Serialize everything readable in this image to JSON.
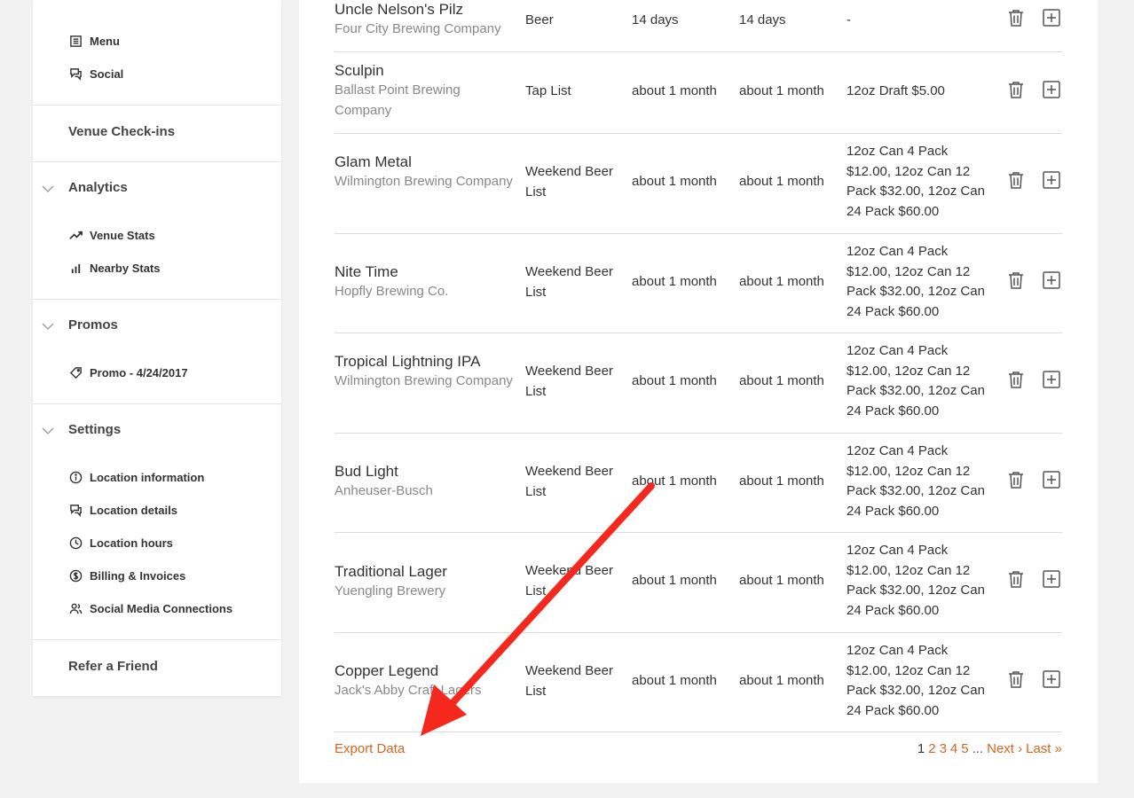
{
  "sidebar": {
    "top_items": [
      {
        "label": "Menu",
        "icon": "menu-icon"
      },
      {
        "label": "Social",
        "icon": "chat-icon"
      }
    ],
    "venue_checkins": "Venue Check-ins",
    "analytics": {
      "title": "Analytics",
      "items": [
        {
          "label": "Venue Stats",
          "icon": "trending-icon"
        },
        {
          "label": "Nearby Stats",
          "icon": "bar-chart-icon"
        }
      ]
    },
    "promos": {
      "title": "Promos",
      "items": [
        {
          "label": "Promo - 4/24/2017",
          "icon": "tag-icon"
        }
      ]
    },
    "settings": {
      "title": "Settings",
      "items": [
        {
          "label": "Location information",
          "icon": "info-icon"
        },
        {
          "label": "Location details",
          "icon": "chat-icon"
        },
        {
          "label": "Location hours",
          "icon": "clock-icon"
        },
        {
          "label": "Billing & Invoices",
          "icon": "dollar-icon"
        },
        {
          "label": "Social Media Connections",
          "icon": "users-icon"
        }
      ]
    },
    "refer": "Refer a Friend"
  },
  "table": {
    "rows": [
      {
        "name": "Uncle Nelson's Pilz",
        "brewery": "Four City Brewing Company",
        "list": "Beer",
        "added": "14 days",
        "updated": "14 days",
        "price": "-"
      },
      {
        "name": "Sculpin",
        "brewery": "Ballast Point Brewing Company",
        "list": "Tap List",
        "added": "about 1 month",
        "updated": "about 1 month",
        "price": "12oz Draft $5.00"
      },
      {
        "name": "Glam Metal",
        "brewery": "Wilmington Brewing Company",
        "list": "Weekend Beer List",
        "added": "about 1 month",
        "updated": "about 1 month",
        "price": "12oz Can 4 Pack $12.00, 12oz Can 12 Pack $32.00, 12oz Can 24 Pack $60.00"
      },
      {
        "name": "Nite Time",
        "brewery": "Hopfly Brewing Co.",
        "list": "Weekend Beer List",
        "added": "about 1 month",
        "updated": "about 1 month",
        "price": "12oz Can 4 Pack $12.00, 12oz Can 12 Pack $32.00, 12oz Can 24 Pack $60.00"
      },
      {
        "name": "Tropical Lightning IPA",
        "brewery": "Wilmington Brewing Company",
        "list": "Weekend Beer List",
        "added": "about 1 month",
        "updated": "about 1 month",
        "price": "12oz Can 4 Pack $12.00, 12oz Can 12 Pack $32.00, 12oz Can 24 Pack $60.00"
      },
      {
        "name": "Bud Light",
        "brewery": "Anheuser-Busch",
        "list": "Weekend Beer List",
        "added": "about 1 month",
        "updated": "about 1 month",
        "price": "12oz Can 4 Pack $12.00, 12oz Can 12 Pack $32.00, 12oz Can 24 Pack $60.00"
      },
      {
        "name": "Traditional Lager",
        "brewery": "Yuengling Brewery",
        "list": "Weekend Beer List",
        "added": "about 1 month",
        "updated": "about 1 month",
        "price": "12oz Can 4 Pack $12.00, 12oz Can 12 Pack $32.00, 12oz Can 24 Pack $60.00"
      },
      {
        "name": "Copper Legend",
        "brewery": "Jack's Abby Craft Lagers",
        "list": "Weekend Beer List",
        "added": "about 1 month",
        "updated": "about 1 month",
        "price": "12oz Can 4 Pack $12.00, 12oz Can 12 Pack $32.00, 12oz Can 24 Pack $60.00"
      }
    ]
  },
  "footer": {
    "export_label": "Export Data",
    "pagination": {
      "current": "1",
      "pages": [
        "2",
        "3",
        "4",
        "5"
      ],
      "ellipsis": "...",
      "next": "Next ›",
      "last": "Last »"
    }
  },
  "colors": {
    "accent": "#d9641e",
    "annotation_arrow": "#f5281e"
  },
  "icons": {
    "delete": "trash-icon",
    "add": "plus-square-icon"
  }
}
